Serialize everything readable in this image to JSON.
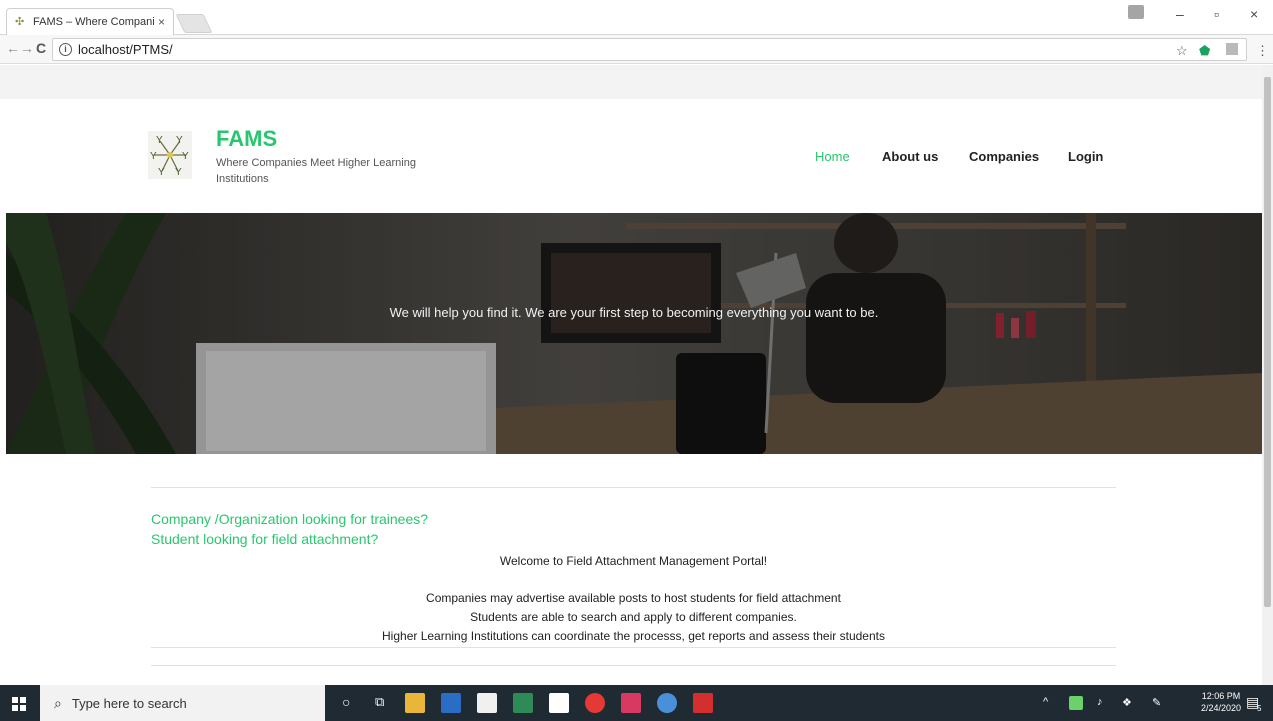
{
  "browser": {
    "tab_title": "FAMS – Where Compani",
    "url": "localhost/PTMS/"
  },
  "site": {
    "brand": "FAMS",
    "tagline": "Where Companies Meet Higher Learning Institutions",
    "nav": [
      {
        "label": "Home",
        "active": true
      },
      {
        "label": "About us",
        "active": false
      },
      {
        "label": "Companies",
        "active": false
      },
      {
        "label": "Login",
        "active": false
      }
    ],
    "hero_text": "We will help you find it. We are your first step to becoming everything you want to be.",
    "prompt_company": "Company /Organization looking for trainees?",
    "prompt_student": "Student looking for field attachment?",
    "welcome": "Welcome to Field Attachment Management Portal!",
    "features": [
      "Companies may advertise available posts to host students for field attachment",
      "Students are able to search and apply to different companies.",
      "Higher Learning Institutions can coordinate the processs, get reports and assess their students"
    ],
    "accent_color": "#28c76f"
  },
  "taskbar": {
    "search_placeholder": "Type here to search",
    "time": "12:06 PM",
    "date": "2/24/2020",
    "notifications": "5"
  }
}
